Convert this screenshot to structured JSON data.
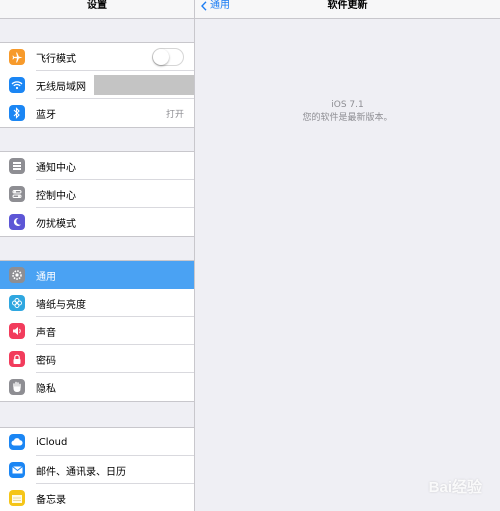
{
  "sidebar": {
    "title": "设置",
    "groups": [
      {
        "items": [
          {
            "label": "飞行模式",
            "icon": "airplane-icon",
            "icon_color": "#f79a2b",
            "toggle_on": false
          },
          {
            "label": "无线局域网",
            "icon": "wifi-icon",
            "icon_color": "#1b86f4"
          },
          {
            "label": "蓝牙",
            "icon": "bluetooth-icon",
            "icon_color": "#1b86f4",
            "value": "打开"
          }
        ]
      },
      {
        "items": [
          {
            "label": "通知中心",
            "icon": "notification-center-icon",
            "icon_color": "#8e8e93"
          },
          {
            "label": "控制中心",
            "icon": "control-center-icon",
            "icon_color": "#8e8e93"
          },
          {
            "label": "勿扰模式",
            "icon": "moon-icon",
            "icon_color": "#5d56d6"
          }
        ]
      },
      {
        "items": [
          {
            "label": "通用",
            "icon": "gear-icon",
            "icon_color": "#8e8e93",
            "selected": true
          },
          {
            "label": "墙纸与亮度",
            "icon": "wallpaper-icon",
            "icon_color": "#2fa7e0"
          },
          {
            "label": "声音",
            "icon": "speaker-icon",
            "icon_color": "#f23c5c"
          },
          {
            "label": "密码",
            "icon": "lock-icon",
            "icon_color": "#f23c5c"
          },
          {
            "label": "隐私",
            "icon": "hand-icon",
            "icon_color": "#8e8e93"
          }
        ]
      },
      {
        "items": [
          {
            "label": "iCloud",
            "icon": "cloud-icon",
            "icon_color": "#1b86f4"
          },
          {
            "label": "邮件、通讯录、日历",
            "icon": "mail-icon",
            "icon_color": "#1b86f4"
          },
          {
            "label": "备忘录",
            "icon": "notes-icon",
            "icon_color": "#f5c518"
          }
        ]
      }
    ]
  },
  "detail": {
    "back_label": "通用",
    "title": "软件更新",
    "version": "iOS 7.1",
    "status": "您的软件是最新版本。"
  },
  "watermark": "Bai经验"
}
